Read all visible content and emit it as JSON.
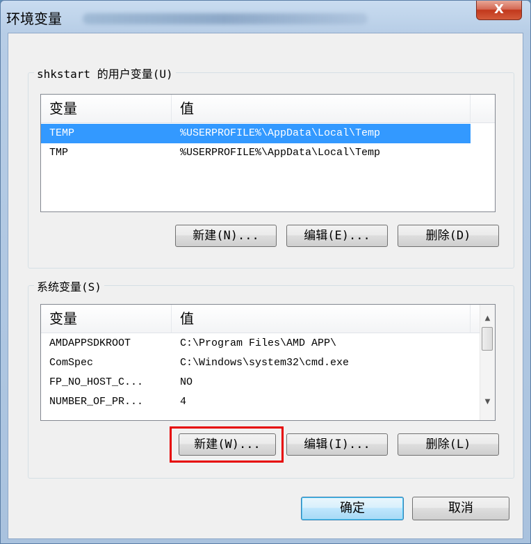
{
  "window": {
    "title": "环境变量",
    "close_label": "X"
  },
  "user_vars": {
    "group_label": "shkstart 的用户变量(U)",
    "columns": [
      "变量",
      "值"
    ],
    "rows": [
      {
        "name": "TEMP",
        "value": "%USERPROFILE%\\AppData\\Local\\Temp",
        "selected": true
      },
      {
        "name": "TMP",
        "value": "%USERPROFILE%\\AppData\\Local\\Temp",
        "selected": false
      }
    ],
    "buttons": {
      "new": "新建(N)...",
      "edit": "编辑(E)...",
      "delete": "删除(D)"
    }
  },
  "system_vars": {
    "group_label": "系统变量(S)",
    "columns": [
      "变量",
      "值"
    ],
    "rows": [
      {
        "name": "AMDAPPSDKROOT",
        "value": "C:\\Program Files\\AMD APP\\"
      },
      {
        "name": "ComSpec",
        "value": "C:\\Windows\\system32\\cmd.exe"
      },
      {
        "name": "FP_NO_HOST_C...",
        "value": "NO"
      },
      {
        "name": "NUMBER_OF_PR...",
        "value": "4"
      }
    ],
    "buttons": {
      "new": "新建(W)...",
      "edit": "编辑(I)...",
      "delete": "删除(L)"
    },
    "scroll_up_icon": "▲",
    "scroll_down_icon": "▼"
  },
  "footer": {
    "ok": "确定",
    "cancel": "取消"
  },
  "colors": {
    "selection": "#3399ff",
    "highlight_box": "#e60000"
  }
}
